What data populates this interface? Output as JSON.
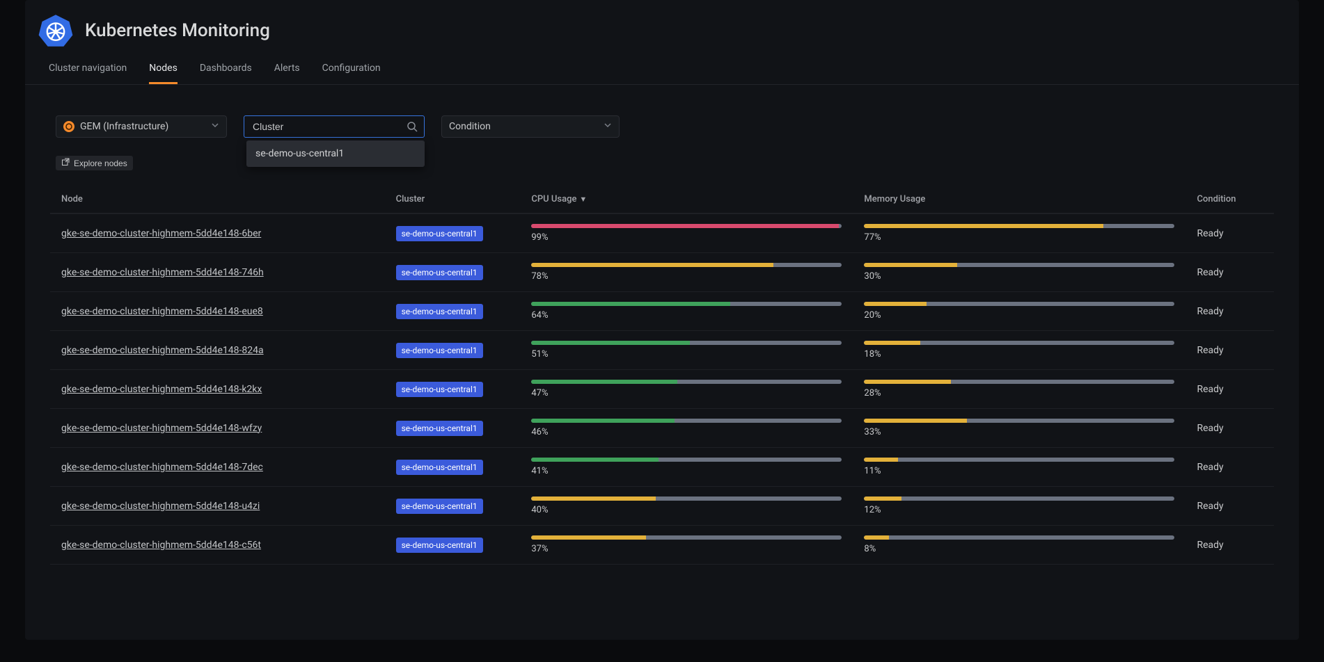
{
  "header": {
    "title": "Kubernetes Monitoring"
  },
  "tabs": {
    "cluster_nav": "Cluster navigation",
    "nodes": "Nodes",
    "dashboards": "Dashboards",
    "alerts": "Alerts",
    "configuration": "Configuration"
  },
  "controls": {
    "datasource_label": "GEM (Infrastructure)",
    "cluster_input_value": "Cluster",
    "condition_label": "Condition",
    "dropdown_option": "se-demo-us-central1"
  },
  "explore_button": "Explore nodes",
  "table": {
    "headers": {
      "node": "Node",
      "cluster": "Cluster",
      "cpu": "CPU Usage",
      "memory": "Memory Usage",
      "condition": "Condition"
    },
    "sort_indicator": "▼",
    "rows": [
      {
        "node": "gke-se-demo-cluster-highmem-5dd4e148-6ber",
        "cluster": "se-demo-us-central1",
        "cpu": 99,
        "cpu_color": "#d94a6e",
        "mem": 77,
        "mem_color": "#e3b13a",
        "condition": "Ready"
      },
      {
        "node": "gke-se-demo-cluster-highmem-5dd4e148-746h",
        "cluster": "se-demo-us-central1",
        "cpu": 78,
        "cpu_color": "#e3b13a",
        "mem": 30,
        "mem_color": "#e3b13a",
        "condition": "Ready"
      },
      {
        "node": "gke-se-demo-cluster-highmem-5dd4e148-eue8",
        "cluster": "se-demo-us-central1",
        "cpu": 64,
        "cpu_color": "#3fa25b",
        "mem": 20,
        "mem_color": "#e3b13a",
        "condition": "Ready"
      },
      {
        "node": "gke-se-demo-cluster-highmem-5dd4e148-824a",
        "cluster": "se-demo-us-central1",
        "cpu": 51,
        "cpu_color": "#3fa25b",
        "mem": 18,
        "mem_color": "#e3b13a",
        "condition": "Ready"
      },
      {
        "node": "gke-se-demo-cluster-highmem-5dd4e148-k2kx",
        "cluster": "se-demo-us-central1",
        "cpu": 47,
        "cpu_color": "#3fa25b",
        "mem": 28,
        "mem_color": "#e3b13a",
        "condition": "Ready"
      },
      {
        "node": "gke-se-demo-cluster-highmem-5dd4e148-wfzy",
        "cluster": "se-demo-us-central1",
        "cpu": 46,
        "cpu_color": "#3fa25b",
        "mem": 33,
        "mem_color": "#e3b13a",
        "condition": "Ready"
      },
      {
        "node": "gke-se-demo-cluster-highmem-5dd4e148-7dec",
        "cluster": "se-demo-us-central1",
        "cpu": 41,
        "cpu_color": "#3fa25b",
        "mem": 11,
        "mem_color": "#e3b13a",
        "condition": "Ready"
      },
      {
        "node": "gke-se-demo-cluster-highmem-5dd4e148-u4zi",
        "cluster": "se-demo-us-central1",
        "cpu": 40,
        "cpu_color": "#e3b13a",
        "mem": 12,
        "mem_color": "#e3b13a",
        "condition": "Ready"
      },
      {
        "node": "gke-se-demo-cluster-highmem-5dd4e148-c56t",
        "cluster": "se-demo-us-central1",
        "cpu": 37,
        "cpu_color": "#e3b13a",
        "mem": 8,
        "mem_color": "#e3b13a",
        "condition": "Ready"
      }
    ]
  }
}
